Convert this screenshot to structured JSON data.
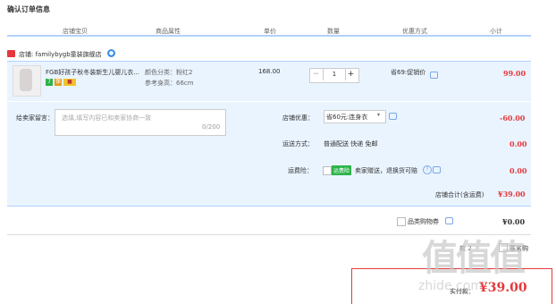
{
  "page": {
    "title": "确认订单信息"
  },
  "table_headers": [
    "店铺宝贝",
    "商品属性",
    "单价",
    "数量",
    "优惠方式",
    "小计"
  ],
  "shop": {
    "label": "店铺: familybygb童装旗舰店"
  },
  "item": {
    "name": "FGB好孩子秋冬装新生儿婴儿衣...",
    "badges": [
      "7",
      "保",
      "■"
    ],
    "attr_color": "颜色分类：粉红2",
    "attr_size": "参考身高：66cm",
    "price": "168.00",
    "quantity": "1",
    "qty_minus": "−",
    "qty_plus": "+",
    "discount": "省69:促销价",
    "subtotal": "99.00"
  },
  "message": {
    "label": "给卖家留言：",
    "placeholder": "选填,填写内容已和卖家协商一致",
    "count": "0/200"
  },
  "coupon": {
    "label": "店铺优惠：",
    "value": "省60元:连身衣",
    "amount": "-60.00"
  },
  "shipping": {
    "label": "运送方式：",
    "value": "普通配送 快递 免邮",
    "amount": "0.00"
  },
  "insurance": {
    "label": "运费险：",
    "tag": "运费险",
    "text": "卖家赠送，退换货可赔",
    "amount": "0.00"
  },
  "shop_total": {
    "label": "店铺合计(含运费)",
    "amount": "¥39.00"
  },
  "gift_card": {
    "label": "品类购物券",
    "amount": "¥0.00"
  },
  "partial_row": {
    "text": "款 2",
    "right": "匿名购"
  },
  "summary": {
    "label": "实付款：",
    "amount": "¥39.00"
  },
  "watermark": {
    "logo": "值值值",
    "site": "zhide.com"
  },
  "colors": {
    "accent_red": "#e4393c",
    "header_line": "#b2d1ff",
    "row_bg": "#eaf4ff"
  }
}
